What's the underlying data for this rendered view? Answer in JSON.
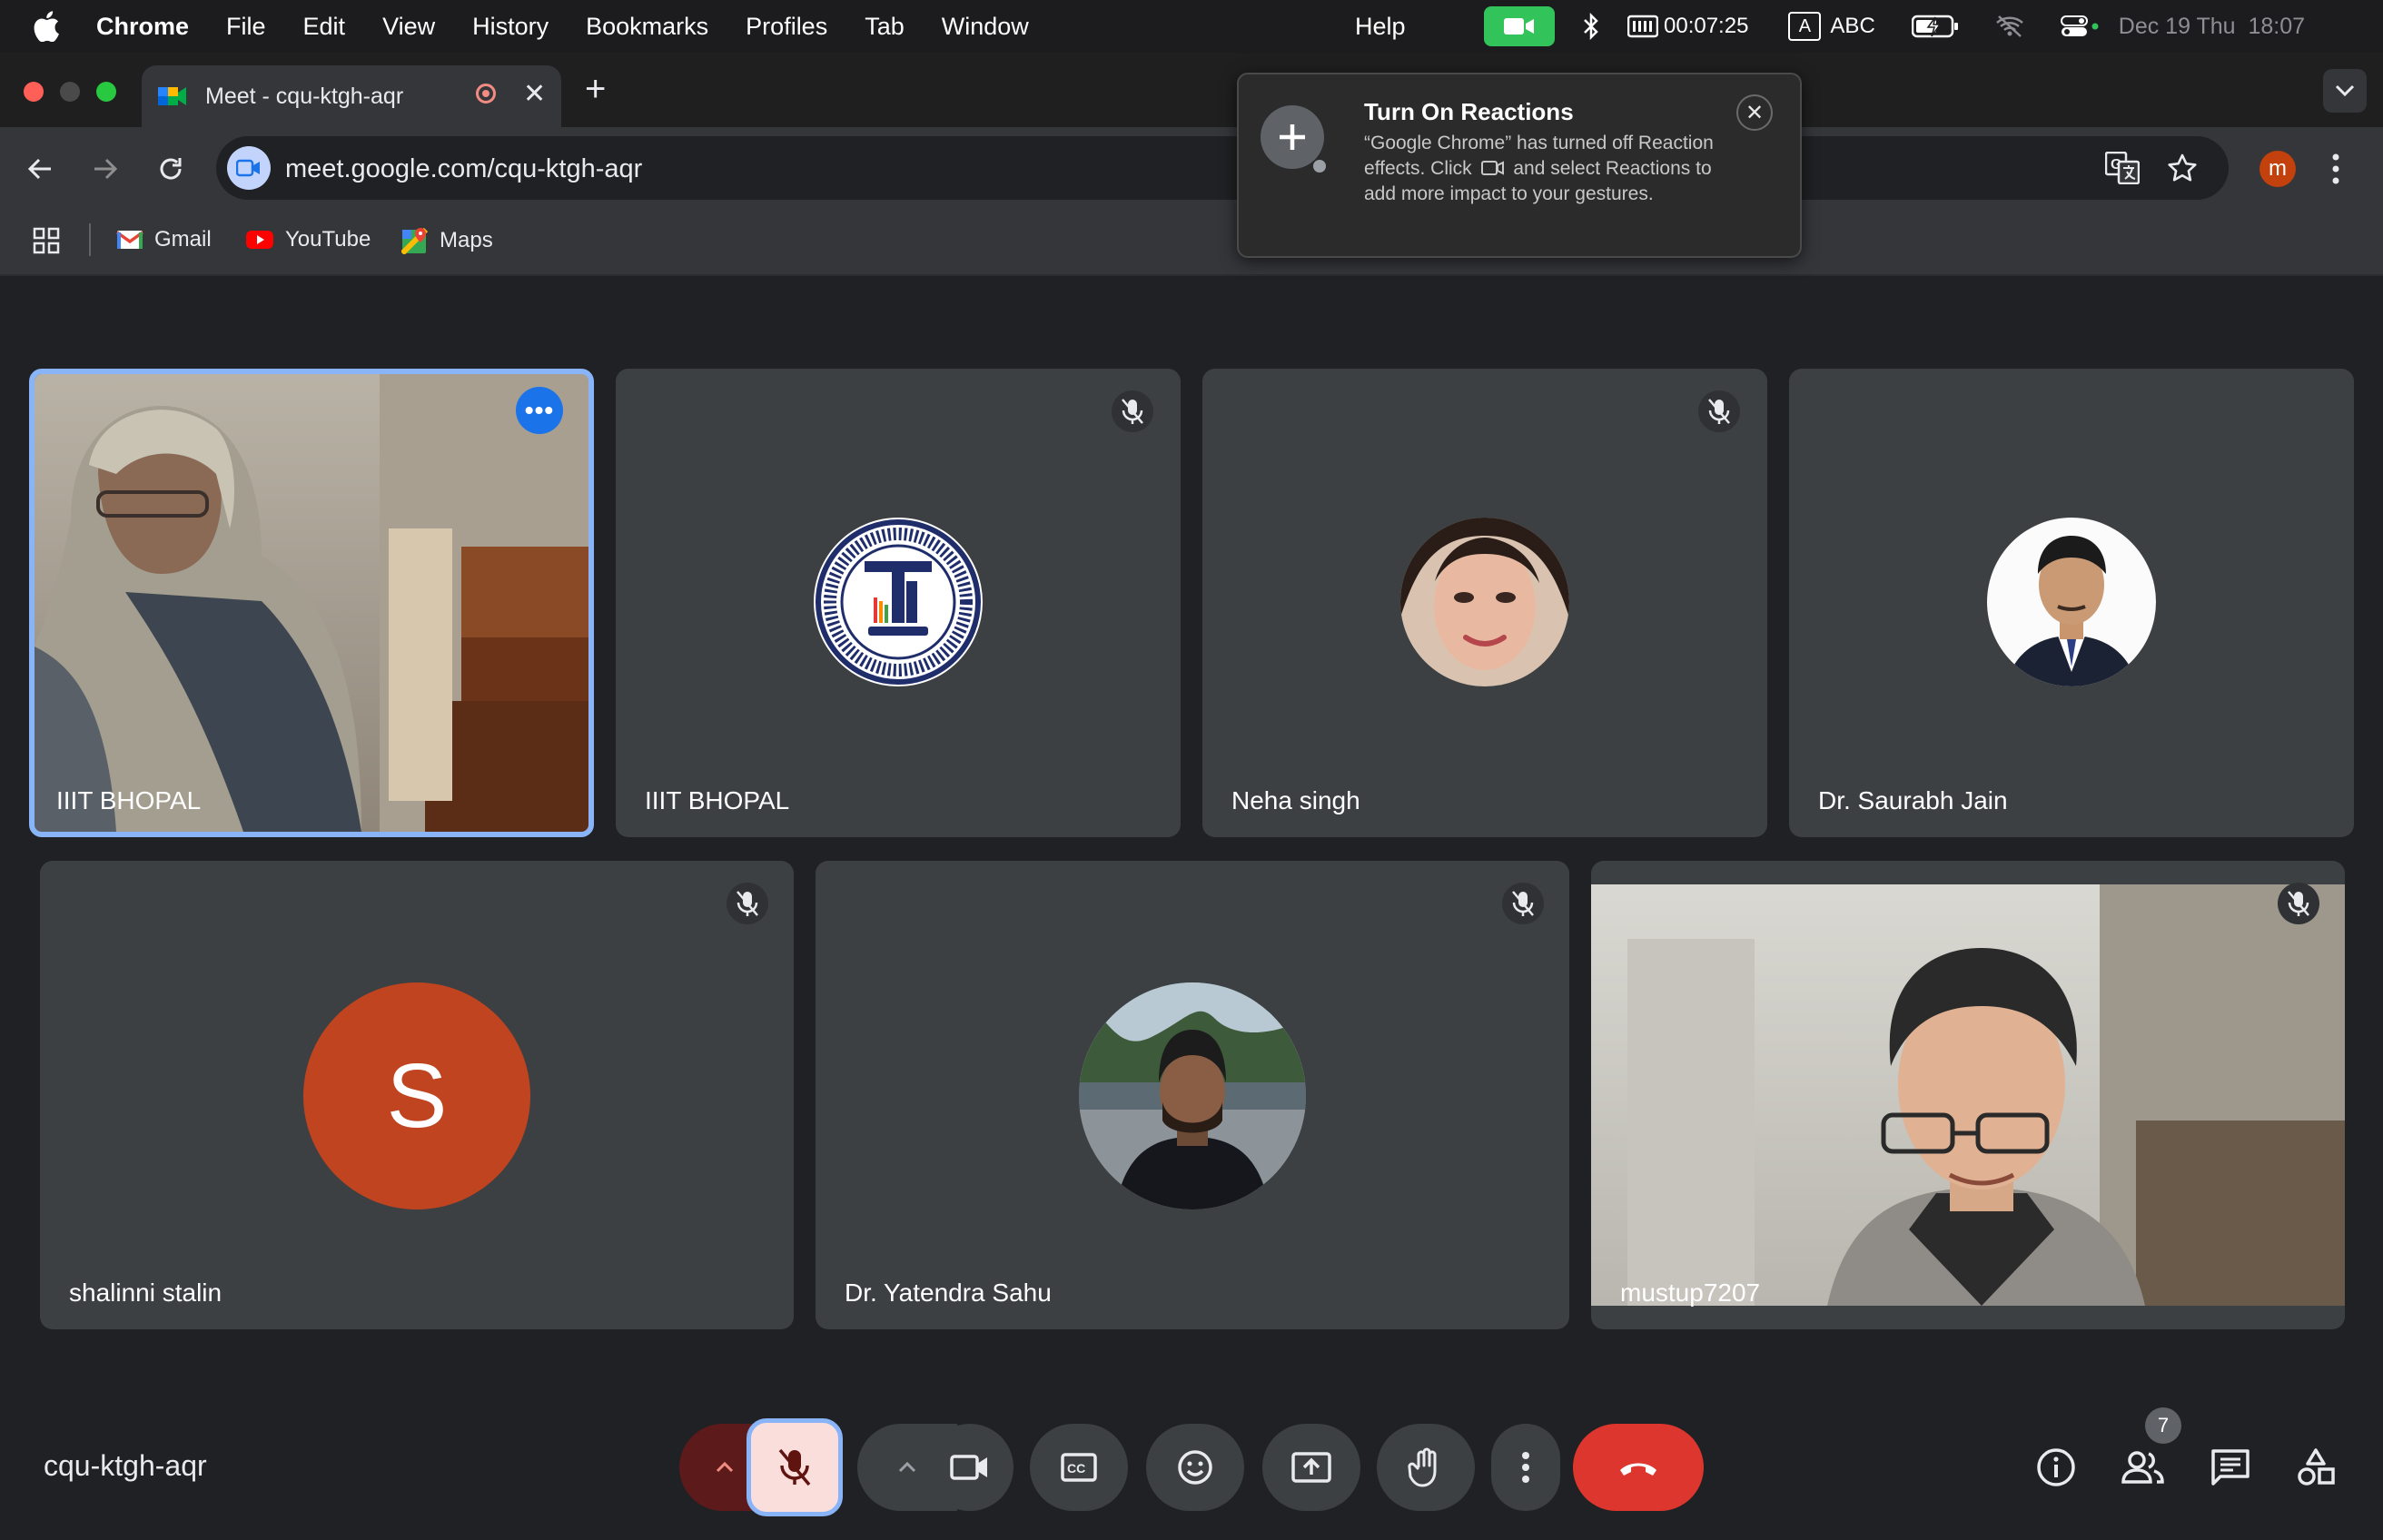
{
  "menubar": {
    "app_name": "Chrome",
    "menus": [
      "File",
      "Edit",
      "View",
      "History",
      "Bookmarks",
      "Profiles",
      "Tab",
      "Window"
    ],
    "help": "Help",
    "timer": "00:07:25",
    "input_source": "ABC",
    "input_letter": "A",
    "datetime": "Dec 19 Thu  18:07"
  },
  "tab": {
    "title": "Meet - cqu-ktgh-aqr",
    "close": "✕",
    "new_tab": "+"
  },
  "toolbar": {
    "url": "meet.google.com/cqu-ktgh-aqr",
    "profile_initial": "m"
  },
  "bookmarks": [
    {
      "label": "Gmail",
      "icon": "gmail-icon"
    },
    {
      "label": "YouTube",
      "icon": "youtube-icon"
    },
    {
      "label": "Maps",
      "icon": "maps-icon"
    }
  ],
  "popup": {
    "title": "Turn On Reactions",
    "body_part1": "“Google Chrome” has turned off Reaction effects. Click",
    "body_part2": "and select Reactions to add more impact to your gestures.",
    "close": "✕"
  },
  "participants": [
    {
      "name": "IIIT BHOPAL",
      "type": "video",
      "muted": false,
      "active": true
    },
    {
      "name": "IIIT BHOPAL",
      "type": "logo",
      "muted": true
    },
    {
      "name": "Neha singh",
      "type": "photo",
      "muted": true
    },
    {
      "name": "Dr. Saurabh Jain",
      "type": "photo",
      "muted": true
    },
    {
      "name": "shalinni stalin",
      "type": "initial",
      "initial": "S",
      "muted": true
    },
    {
      "name": "Dr. Yatendra Sahu",
      "type": "photo",
      "muted": true
    },
    {
      "name": "mustup7207",
      "type": "video",
      "muted": true
    }
  ],
  "bottom": {
    "meeting_code": "cqu-ktgh-aqr",
    "people_count": "7"
  },
  "colors": {
    "background": "#202124",
    "tile": "#3c4043",
    "accent": "#8ab4f8",
    "end_call": "#ea4335",
    "initial_avatar": "#c0441f"
  }
}
